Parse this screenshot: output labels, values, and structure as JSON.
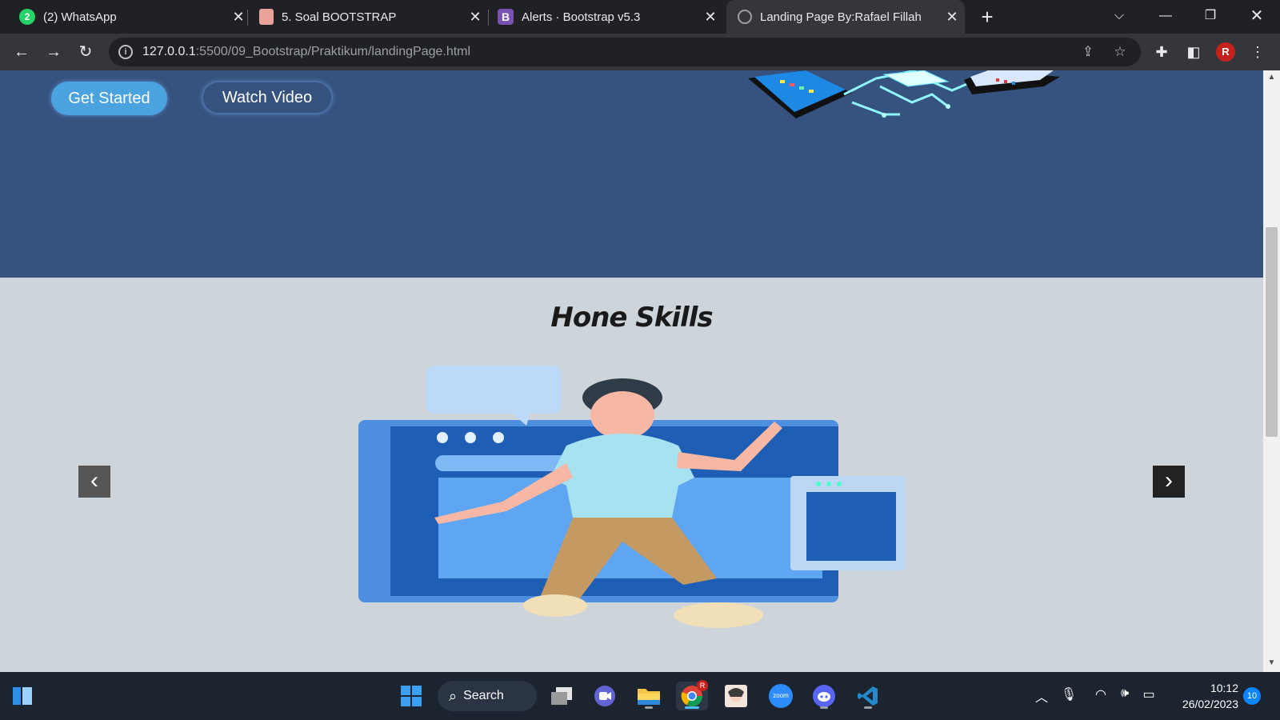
{
  "browser": {
    "tabs": [
      {
        "title": "(2) WhatsApp",
        "favicon": "whatsapp-icon",
        "badge": "2"
      },
      {
        "title": "5. Soal BOOTSTRAP",
        "favicon": "document-icon"
      },
      {
        "title": "Alerts · Bootstrap v5.3",
        "favicon": "bootstrap-icon",
        "favicon_letter": "B"
      },
      {
        "title": "Landing Page By:Rafael Fillah",
        "favicon": "globe-icon",
        "active": true
      }
    ],
    "address": {
      "host": "127.0.0.1",
      "path": ":5500/09_Bootstrap/Praktikum/landingPage.html"
    },
    "profile_initial": "R"
  },
  "page": {
    "hero": {
      "get_started_label": "Get Started",
      "watch_video_label": "Watch Video"
    },
    "skills": {
      "title": "Hone Skills"
    }
  },
  "taskbar": {
    "search_label": "Search",
    "chrome_badge": "R",
    "zoom_label": "zoom",
    "clock_time": "10:12",
    "clock_date": "26/02/2023",
    "notification_count": "10"
  },
  "colors": {
    "hero_bg": "#36527f",
    "section_bg": "#cdd4da",
    "accent_button": "#4aa3df",
    "taskbar_bg": "#1c2430"
  }
}
